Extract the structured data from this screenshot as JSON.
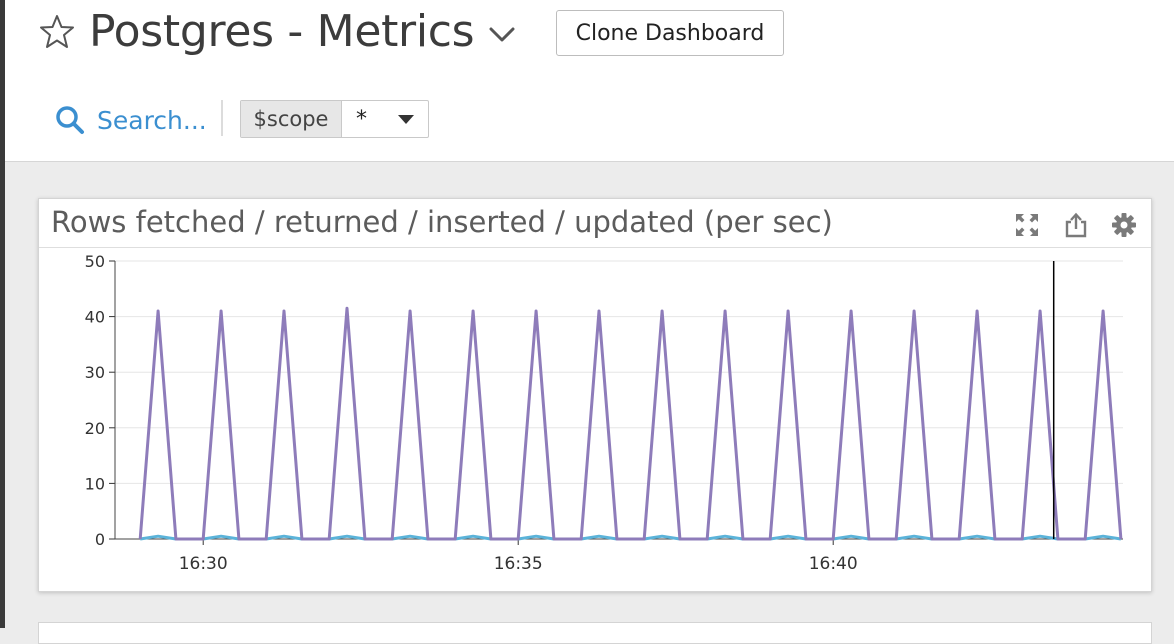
{
  "header": {
    "title": "Postgres - Metrics",
    "clone_label": "Clone Dashboard",
    "search_label": "Search...",
    "scope_label": "$scope",
    "scope_value": "*"
  },
  "widget": {
    "title": "Rows fetched / returned / inserted / updated (per sec)",
    "tools": [
      "expand-icon",
      "share-icon",
      "gear-icon"
    ]
  },
  "chart_data": {
    "type": "line",
    "title": "Rows fetched / returned / inserted / updated (per sec)",
    "xlabel": "",
    "ylabel": "",
    "ylim": [
      0,
      50
    ],
    "xlim": [
      "16:28:36",
      "16:44:36"
    ],
    "yticks": [
      "0",
      "10",
      "20",
      "30",
      "40",
      "50"
    ],
    "xticks": [
      "16:30",
      "16:35",
      "16:40"
    ],
    "grid": true,
    "cursor_time": "16:43:30",
    "colors": {
      "purple": "#8e7cba",
      "blue": "#5bb3d9",
      "grid": "#e6e6e6"
    },
    "series": [
      {
        "color": "#8e7cba",
        "x": [
          "16:29:00",
          "16:29:17",
          "16:29:34",
          "16:30:00",
          "16:30:17",
          "16:30:34",
          "16:31:00",
          "16:31:17",
          "16:31:34",
          "16:32:00",
          "16:32:17",
          "16:32:34",
          "16:33:00",
          "16:33:17",
          "16:33:34",
          "16:34:00",
          "16:34:17",
          "16:34:34",
          "16:35:00",
          "16:35:17",
          "16:35:34",
          "16:36:00",
          "16:36:17",
          "16:36:34",
          "16:37:00",
          "16:37:17",
          "16:37:34",
          "16:38:00",
          "16:38:17",
          "16:38:34",
          "16:39:00",
          "16:39:17",
          "16:39:34",
          "16:40:00",
          "16:40:17",
          "16:40:34",
          "16:41:00",
          "16:41:17",
          "16:41:34",
          "16:42:00",
          "16:42:17",
          "16:42:34",
          "16:43:00",
          "16:43:17",
          "16:43:34",
          "16:44:00",
          "16:44:17",
          "16:44:34"
        ],
        "values": [
          0,
          41,
          0,
          0,
          41,
          0,
          0,
          41,
          0,
          0,
          41.5,
          0,
          0,
          41,
          0,
          0,
          41,
          0,
          0,
          41,
          0,
          0,
          41,
          0,
          0,
          41,
          0,
          0,
          41,
          0,
          0,
          41,
          0,
          0,
          41,
          0,
          0,
          41,
          0,
          0,
          41,
          0,
          0,
          41,
          0,
          0,
          41,
          0
        ]
      },
      {
        "color": "#5bb3d9",
        "x": [
          "16:29:00",
          "16:29:17",
          "16:29:34",
          "16:30:00",
          "16:30:17",
          "16:30:34",
          "16:31:00",
          "16:31:17",
          "16:31:34",
          "16:32:00",
          "16:32:17",
          "16:32:34",
          "16:33:00",
          "16:33:17",
          "16:33:34",
          "16:34:00",
          "16:34:17",
          "16:34:34",
          "16:35:00",
          "16:35:17",
          "16:35:34",
          "16:36:00",
          "16:36:17",
          "16:36:34",
          "16:37:00",
          "16:37:17",
          "16:37:34",
          "16:38:00",
          "16:38:17",
          "16:38:34",
          "16:39:00",
          "16:39:17",
          "16:39:34",
          "16:40:00",
          "16:40:17",
          "16:40:34",
          "16:41:00",
          "16:41:17",
          "16:41:34",
          "16:42:00",
          "16:42:17",
          "16:42:34",
          "16:43:00",
          "16:43:17",
          "16:43:34",
          "16:44:00",
          "16:44:17",
          "16:44:34"
        ],
        "values": [
          0,
          0.5,
          0,
          0,
          0.5,
          0,
          0,
          0.5,
          0,
          0,
          0.5,
          0,
          0,
          0.5,
          0,
          0,
          0.5,
          0,
          0,
          0.5,
          0,
          0,
          0.5,
          0,
          0,
          0.5,
          0,
          0,
          0.5,
          0,
          0,
          0.5,
          0,
          0,
          0.5,
          0,
          0,
          0.5,
          0,
          0,
          0.5,
          0,
          0,
          0.5,
          0,
          0,
          0.5,
          0
        ]
      }
    ]
  }
}
